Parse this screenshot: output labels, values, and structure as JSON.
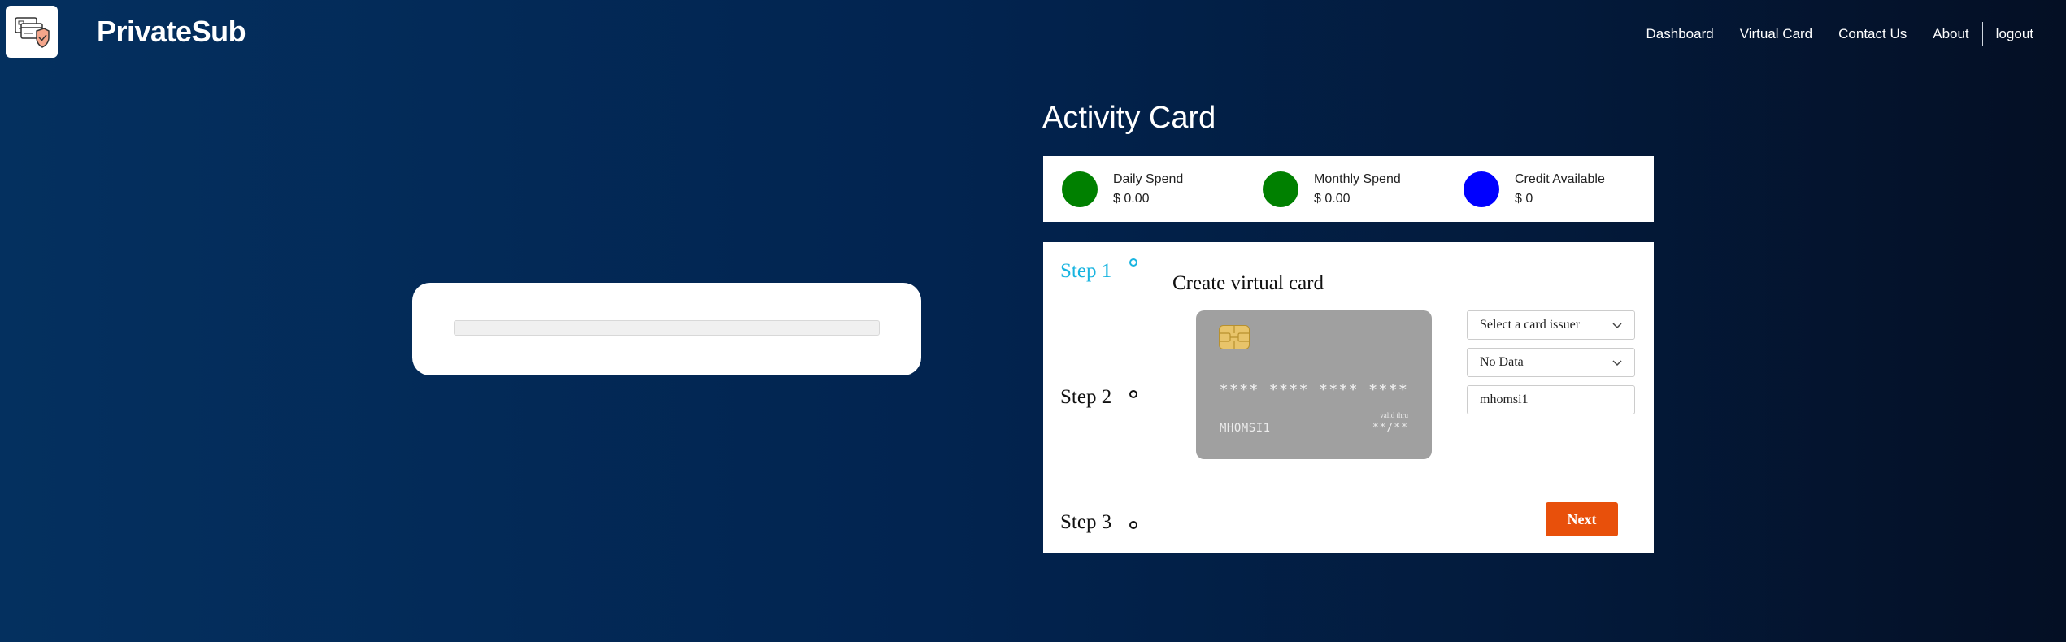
{
  "header": {
    "brand": "PrivateSub",
    "nav": {
      "dashboard": "Dashboard",
      "virtual_card": "Virtual Card",
      "contact_us": "Contact Us",
      "about": "About",
      "logout": "logout"
    }
  },
  "activity": {
    "title": "Activity Card",
    "stats": [
      {
        "label": "Daily Spend",
        "value": "$ 0.00",
        "color": "#008000"
      },
      {
        "label": "Monthly Spend",
        "value": "$ 0.00",
        "color": "#008000"
      },
      {
        "label": "Credit Available",
        "value": "$ 0",
        "color": "#0000ff"
      }
    ]
  },
  "stepper": {
    "steps": [
      "Step 1",
      "Step 2",
      "Step 3"
    ],
    "active_step": 1,
    "create_title": "Create virtual card",
    "card": {
      "number": "**** **** **** ****",
      "name": "MHOMSI1",
      "valid_thru_label": "valid thru",
      "expiry": "**/**"
    },
    "issuer_select": "Select a card issuer",
    "data_select": "No Data",
    "name_input": "mhomsi1",
    "next_label": "Next"
  }
}
